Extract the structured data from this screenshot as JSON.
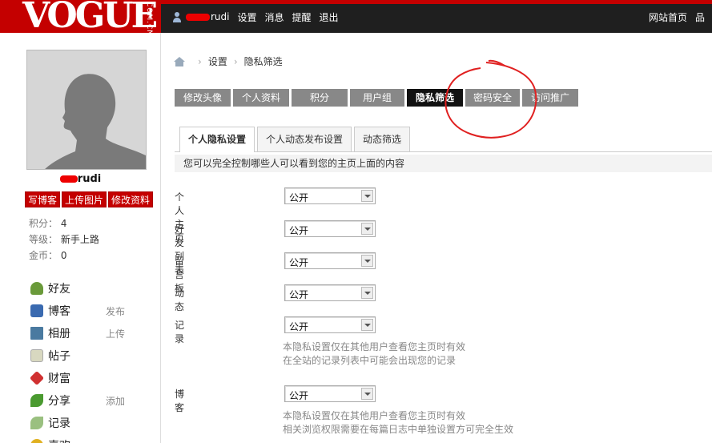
{
  "header": {
    "logo": "VOGUE",
    "logo_sub": "COM.CN",
    "username_suffix": "rudi",
    "nav": [
      "设置",
      "消息",
      "提醒",
      "退出"
    ],
    "right": [
      "网站首页",
      "品"
    ]
  },
  "sidebar": {
    "username_suffix": "rudi",
    "buttons": [
      "写博客",
      "上传图片",
      "修改资料"
    ],
    "stats": [
      {
        "label": "积分：",
        "value": "4"
      },
      {
        "label": "等级：",
        "value": "新手上路"
      },
      {
        "label": "金币：",
        "value": "0"
      }
    ],
    "menu": [
      {
        "label": "好友",
        "sub": "",
        "icon": "friends-icon",
        "color": "#6a9a3a"
      },
      {
        "label": "博客",
        "sub": "发布",
        "icon": "blog-icon",
        "color": "#3a6ab0"
      },
      {
        "label": "相册",
        "sub": "上传",
        "icon": "album-icon",
        "color": "#4a7aa0"
      },
      {
        "label": "帖子",
        "sub": "",
        "icon": "post-icon",
        "color": "#b8b8a0"
      },
      {
        "label": "财富",
        "sub": "",
        "icon": "wealth-icon",
        "color": "#d03030"
      },
      {
        "label": "分享",
        "sub": "添加",
        "icon": "share-icon",
        "color": "#4a9a30"
      },
      {
        "label": "记录",
        "sub": "",
        "icon": "record-icon",
        "color": "#9ac080"
      },
      {
        "label": "喜欢",
        "sub": "",
        "icon": "like-icon",
        "color": "#e0b020"
      }
    ]
  },
  "breadcrumb": [
    "设置",
    "隐私筛选"
  ],
  "tabs_main": [
    {
      "label": "修改头像",
      "active": false
    },
    {
      "label": "个人资料",
      "active": false
    },
    {
      "label": "积分",
      "active": false
    },
    {
      "label": "用户组",
      "active": false
    },
    {
      "label": "隐私筛选",
      "active": true
    },
    {
      "label": "密码安全",
      "active": false
    },
    {
      "label": "访问推广",
      "active": false
    }
  ],
  "tabs_sub": [
    {
      "label": "个人隐私设置",
      "active": true
    },
    {
      "label": "个人动态发布设置",
      "active": false
    },
    {
      "label": "动态筛选",
      "active": false
    }
  ],
  "notice": "您可以完全控制哪些人可以看到您的主页上面的内容",
  "settings": [
    {
      "label": "个人主页",
      "value": "公开",
      "hints": []
    },
    {
      "label": "好友列表",
      "value": "公开",
      "hints": []
    },
    {
      "label": "留言板",
      "value": "公开",
      "hints": []
    },
    {
      "label": "动态",
      "value": "公开",
      "hints": []
    },
    {
      "label": "记录",
      "value": "公开",
      "hints": [
        "本隐私设置仅在其他用户查看您主页时有效",
        "在全站的记录列表中可能会出现您的记录"
      ]
    },
    {
      "label": "博客",
      "value": "公开",
      "hints": [
        "本隐私设置仅在其他用户查看您主页时有效",
        "相关浏览权限需要在每篇日志中单独设置方可完全生效"
      ]
    }
  ]
}
